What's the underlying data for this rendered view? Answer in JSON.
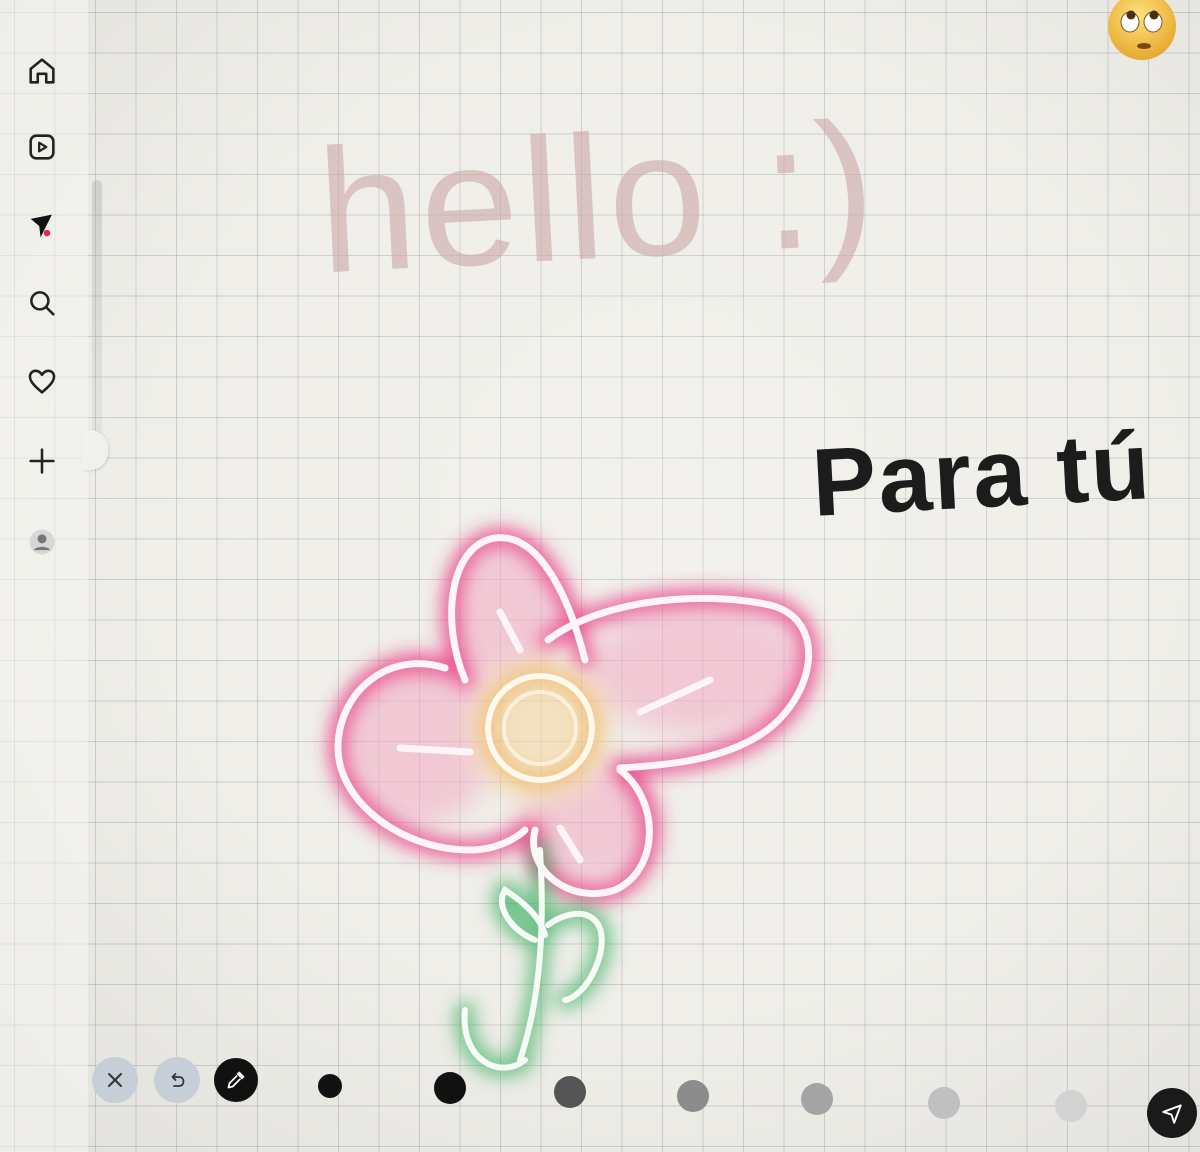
{
  "canvas": {
    "greeting_text": "hello :)",
    "message_text": "Para tú"
  },
  "sidebar": {
    "items": [
      {
        "name": "home",
        "icon": "home-icon"
      },
      {
        "name": "reels",
        "icon": "reels-icon"
      },
      {
        "name": "messages",
        "icon": "paper-plane-icon",
        "badge_color": "#e0245e"
      },
      {
        "name": "search",
        "icon": "search-icon"
      },
      {
        "name": "notifications",
        "icon": "heart-icon"
      },
      {
        "name": "create",
        "icon": "plus-icon"
      },
      {
        "name": "profile",
        "icon": "profile-icon"
      }
    ]
  },
  "toolbar": {
    "close_icon": "close-icon",
    "undo_icon": "undo-icon",
    "eyedropper_icon": "eyedropper-icon",
    "brush_colors": [
      "#111111",
      "#111111",
      "#555555",
      "#8c8c8c",
      "#a4a4a4",
      "#c0c0c0",
      "#d2d2d2"
    ],
    "send_icon": "send-icon"
  },
  "drawing": {
    "petal_glow_color": "#e8327f",
    "stem_glow_color": "#3cb063",
    "center_glow_color": "#f0c06e",
    "greeting_color": "#cdaaa8"
  }
}
